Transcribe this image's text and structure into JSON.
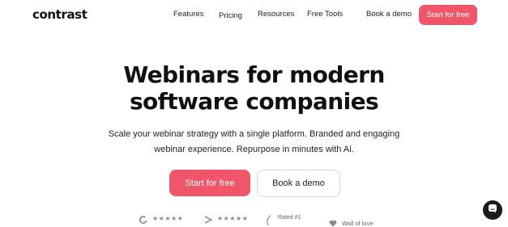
{
  "brand": {
    "logo_text": "contrast"
  },
  "nav": {
    "links": [
      "Features",
      "Pricing",
      "Resources",
      "Free Tools"
    ],
    "book_demo": "Book a demo",
    "cta": "Start for free"
  },
  "hero": {
    "title_line1": "Webinars for modern",
    "title_line2": "software companies",
    "subtitle_line1": "Scale your webinar strategy with a single platform. Branded and engaging",
    "subtitle_line2": "webinar experience. Repurpose in minutes with Ai.",
    "primary_cta": "Start for free",
    "secondary_cta": "Book a demo"
  },
  "badges": {
    "stars": "★★★★★",
    "rated": "Rated #1",
    "wall": "Wall of love"
  },
  "colors": {
    "accent": "#f1556a",
    "chat_bg": "#1a1a1a"
  },
  "icons": [
    "g2-icon",
    "capterra-icon",
    "laurel-icon",
    "heart-icon",
    "chat-icon"
  ]
}
